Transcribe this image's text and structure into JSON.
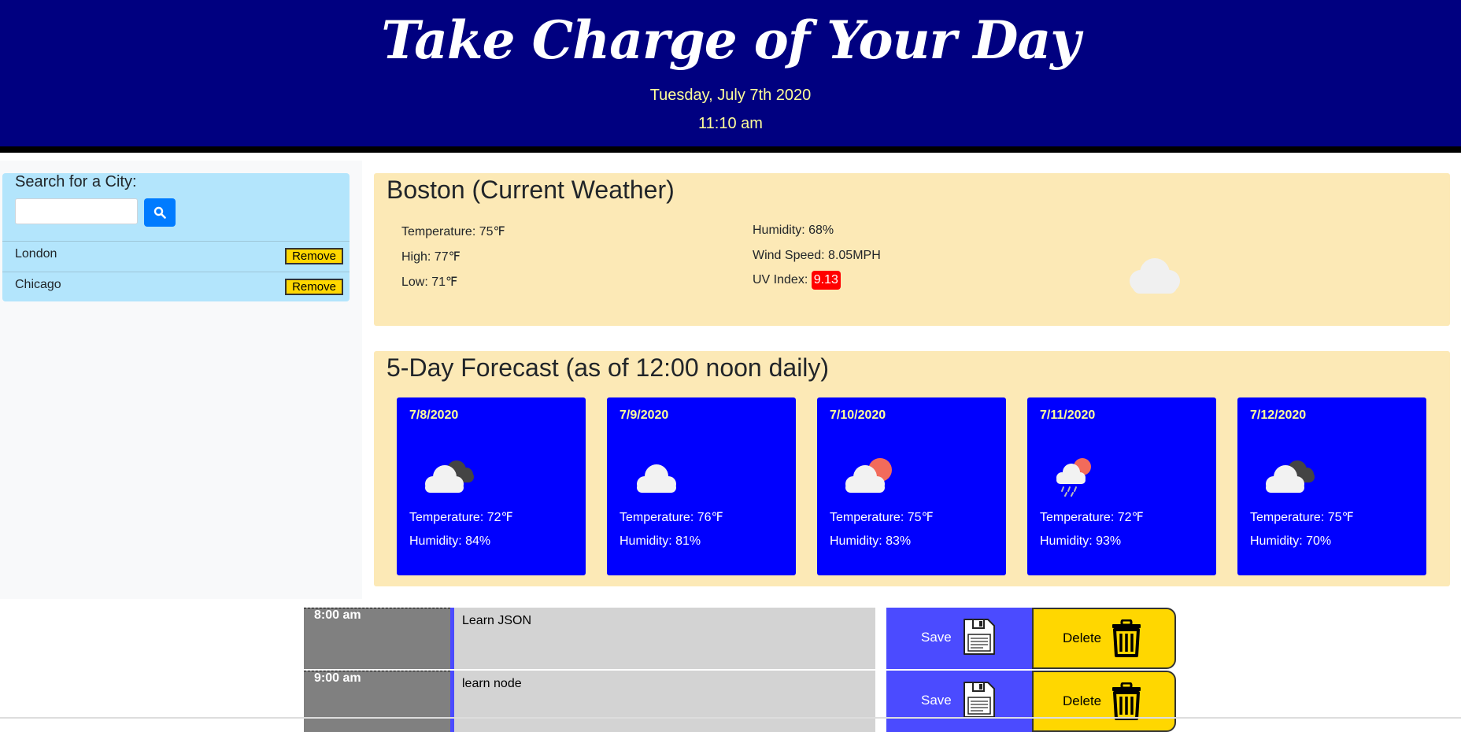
{
  "header": {
    "title": "Take Charge of Your Day",
    "date": "Tuesday, July 7th 2020",
    "time": "11:10 am"
  },
  "sidebar": {
    "search_label": "Search for a City:",
    "search_value": "",
    "search_icon": "search-icon",
    "cities": [
      {
        "name": "London",
        "remove_label": "Remove"
      },
      {
        "name": "Chicago",
        "remove_label": "Remove"
      }
    ]
  },
  "current": {
    "heading": "Boston (Current Weather)",
    "temperature": "Temperature: 75℉",
    "high": "High: 77℉",
    "low": "Low: 71℉",
    "humidity": "Humidity: 68%",
    "wind": "Wind Speed: 8.05MPH",
    "uv_label": "UV Index:",
    "uv_value": "9.13",
    "icon": "cloud-icon"
  },
  "forecast": {
    "heading": "5-Day Forecast (as of 12:00 noon daily)",
    "days": [
      {
        "date": "7/8/2020",
        "icon": "broken-clouds-icon",
        "temp": "Temperature: 72℉",
        "humidity": "Humidity: 84%"
      },
      {
        "date": "7/9/2020",
        "icon": "cloud-icon",
        "temp": "Temperature: 76℉",
        "humidity": "Humidity: 81%"
      },
      {
        "date": "7/10/2020",
        "icon": "partly-cloudy-icon",
        "temp": "Temperature: 75℉",
        "humidity": "Humidity: 83%"
      },
      {
        "date": "7/11/2020",
        "icon": "rain-sun-icon",
        "temp": "Temperature: 72℉",
        "humidity": "Humidity: 93%"
      },
      {
        "date": "7/12/2020",
        "icon": "broken-clouds-icon",
        "temp": "Temperature: 75℉",
        "humidity": "Humidity: 70%"
      }
    ]
  },
  "planner": [
    {
      "hour": "8:00 am",
      "text": "Learn JSON",
      "save_label": "Save",
      "delete_label": "Delete"
    },
    {
      "hour": "9:00 am",
      "text": "learn node",
      "save_label": "Save",
      "delete_label": "Delete"
    }
  ],
  "colors": {
    "header_bg": "#000080",
    "panel_bg": "#fce9b6",
    "card_bg": "#0000ff",
    "uv_badge": "#ff0000",
    "save_bg": "#4b4bff",
    "delete_bg": "#ffd700"
  }
}
